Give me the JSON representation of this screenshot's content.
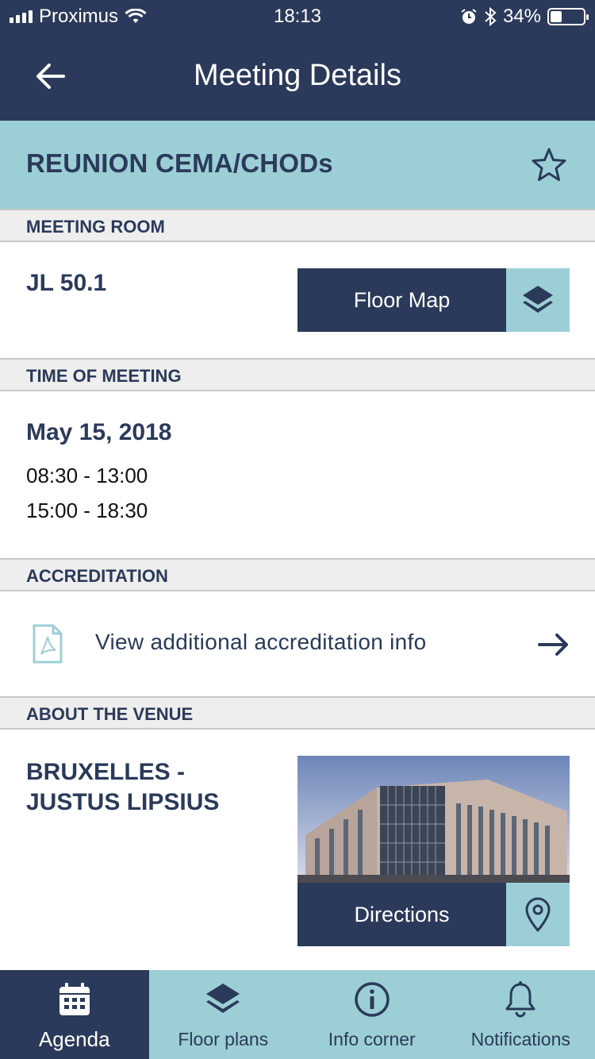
{
  "status_bar": {
    "carrier": "Proximus",
    "time": "18:13",
    "battery_percent": "34%",
    "battery_level": 0.34
  },
  "nav": {
    "title": "Meeting Details",
    "back_icon": "arrow-left-icon"
  },
  "meeting": {
    "title": "REUNION CEMA/CHODs",
    "favorite_icon": "star-outline-icon"
  },
  "sections": {
    "meeting_room": {
      "header": "MEETING ROOM",
      "room": "JL 50.1",
      "button_label": "Floor Map",
      "button_icon": "layers-icon"
    },
    "time_of_meeting": {
      "header": "TIME OF MEETING",
      "date": "May 15, 2018",
      "slots": [
        "08:30 - 13:00",
        "15:00 - 18:30"
      ]
    },
    "accreditation": {
      "header": "ACCREDITATION",
      "label": "View additional accreditation info",
      "icon": "pdf-file-icon",
      "arrow_icon": "arrow-right-icon"
    },
    "venue": {
      "header": "ABOUT THE VENUE",
      "name_line1": "BRUXELLES -",
      "name_line2": "JUSTUS LIPSIUS",
      "button_label": "Directions",
      "button_icon": "map-pin-icon"
    }
  },
  "tabs": [
    {
      "label": "Agenda",
      "icon": "calendar-icon",
      "active": true
    },
    {
      "label": "Floor plans",
      "icon": "layers-icon",
      "active": false
    },
    {
      "label": "Info corner",
      "icon": "info-icon",
      "active": false
    },
    {
      "label": "Notifications",
      "icon": "bell-icon",
      "active": false
    }
  ],
  "colors": {
    "navy": "#2b3a5a",
    "teal": "#9ccfd5",
    "section_gray": "#eeeeee"
  }
}
